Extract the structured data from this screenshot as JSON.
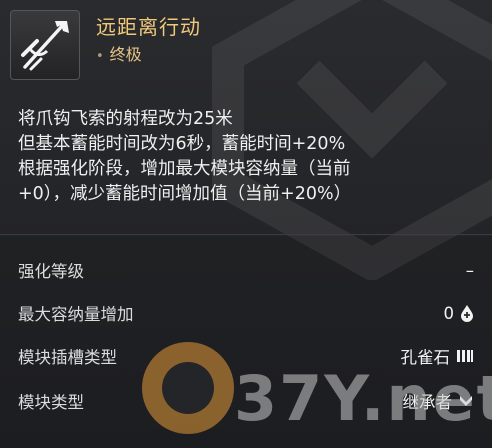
{
  "item": {
    "name": "远距离行动",
    "rank_label": "终极",
    "rank_dot": "•",
    "icon": "grappling-hook-icon"
  },
  "description": {
    "lines": [
      "将爪钩飞索的射程改为25米",
      "但基本蓄能时间改为6秒，蓄能时间+20%",
      "根据强化阶段，增加最大模块容纳量（当前",
      "+0），减少蓄能时间增加值（当前+20%）"
    ]
  },
  "stats": {
    "rows": [
      {
        "label": "强化等级",
        "value": "–",
        "icon": ""
      },
      {
        "label": "最大容纳量增加",
        "value": "0",
        "icon": "capacity-drop-icon"
      },
      {
        "label": "模块插槽类型",
        "value": "孔雀石",
        "icon": "malachite-socket-icon"
      },
      {
        "label": "模块类型",
        "value": "继承者",
        "icon": "descendant-type-icon"
      }
    ]
  },
  "watermark": {
    "text": "37Y.net"
  },
  "colors": {
    "name": "#f0c97a",
    "rank": "#e4c287",
    "background": "#242528",
    "watermark_circle": "#e49a39"
  }
}
